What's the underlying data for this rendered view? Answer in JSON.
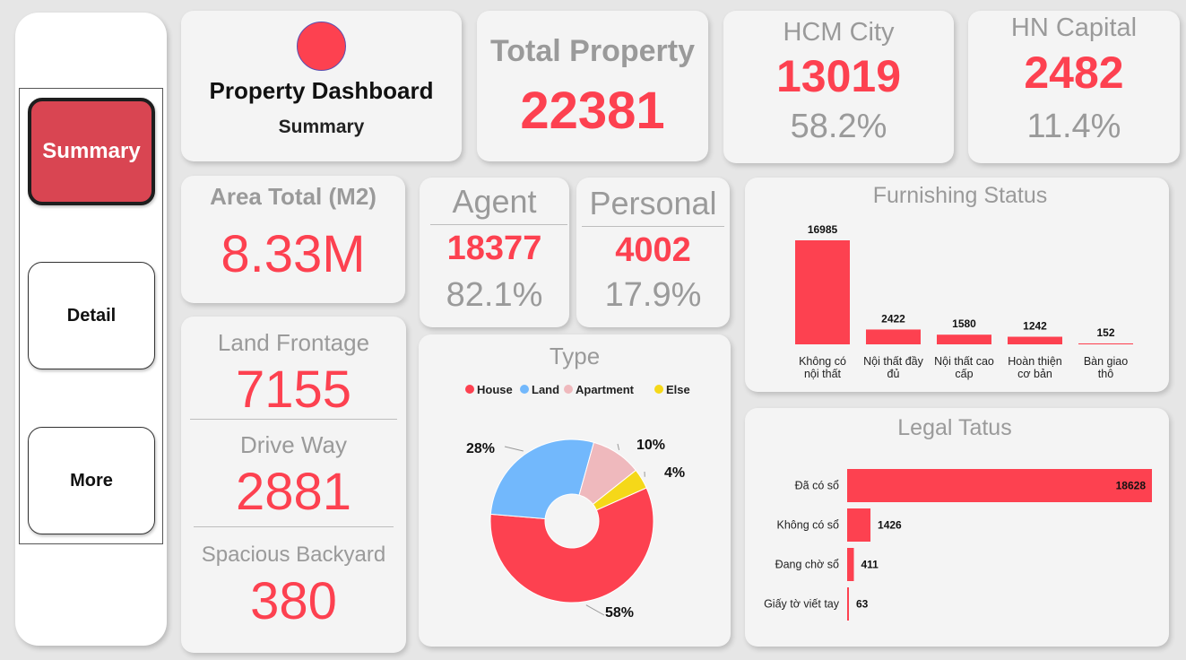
{
  "nav": {
    "items": [
      {
        "label": "Summary",
        "active": true
      },
      {
        "label": "Detail",
        "active": false
      },
      {
        "label": "More",
        "active": false
      }
    ]
  },
  "header": {
    "title": "Property Dashboard",
    "subtitle": "Summary",
    "logo_color": "#fd4150"
  },
  "total": {
    "label": "Total Property",
    "value": "22381"
  },
  "hcm": {
    "label": "HCM City",
    "value": "13019",
    "pct": "58.2%"
  },
  "hn": {
    "label": "HN Capital",
    "value": "2482",
    "pct": "11.4%"
  },
  "area": {
    "label": "Area Total (M2)",
    "value": "8.33M"
  },
  "agent": {
    "label": "Agent",
    "value": "18377",
    "pct": "82.1%"
  },
  "personal": {
    "label": "Personal",
    "value": "4002",
    "pct": "17.9%"
  },
  "features": {
    "land_frontage": {
      "label": "Land Frontage",
      "value": "7155"
    },
    "drive_way": {
      "label": "Drive Way",
      "value": "2881"
    },
    "backyard": {
      "label": "Spacious Backyard",
      "value": "380"
    }
  },
  "colors": {
    "accent": "#fd4150",
    "muted": "#9a9a9a",
    "blue": "#72b8fc",
    "pink": "#efb9bd",
    "yellow": "#f5d819"
  },
  "chart_data": [
    {
      "type": "pie",
      "title": "Type",
      "categories": [
        "House",
        "Land",
        "Apartment",
        "Else"
      ],
      "values": [
        58,
        28,
        10,
        4
      ],
      "labels": [
        "58%",
        "28%",
        "10%",
        "4%"
      ],
      "colors": [
        "#fd4150",
        "#72b8fc",
        "#efb9bd",
        "#f5d819"
      ],
      "legend": "top"
    },
    {
      "type": "bar",
      "title": "Furnishing Status",
      "categories": [
        [
          "Không có",
          "nội thất"
        ],
        [
          "Nội thất đầy",
          "đủ"
        ],
        [
          "Nội thất cao",
          "cấp"
        ],
        [
          "Hoàn thiện",
          "cơ bản"
        ],
        [
          "Bàn giao",
          "thô"
        ]
      ],
      "values": [
        16985,
        2422,
        1580,
        1242,
        152
      ],
      "color": "#fd4150"
    },
    {
      "type": "bar",
      "orientation": "horizontal",
      "title": "Legal Tatus",
      "categories": [
        "Đã có sổ",
        "Không có sổ",
        "Đang chờ sổ",
        "Giấy tờ viết tay"
      ],
      "values": [
        18628,
        1426,
        411,
        63
      ],
      "color": "#fd4150"
    }
  ]
}
